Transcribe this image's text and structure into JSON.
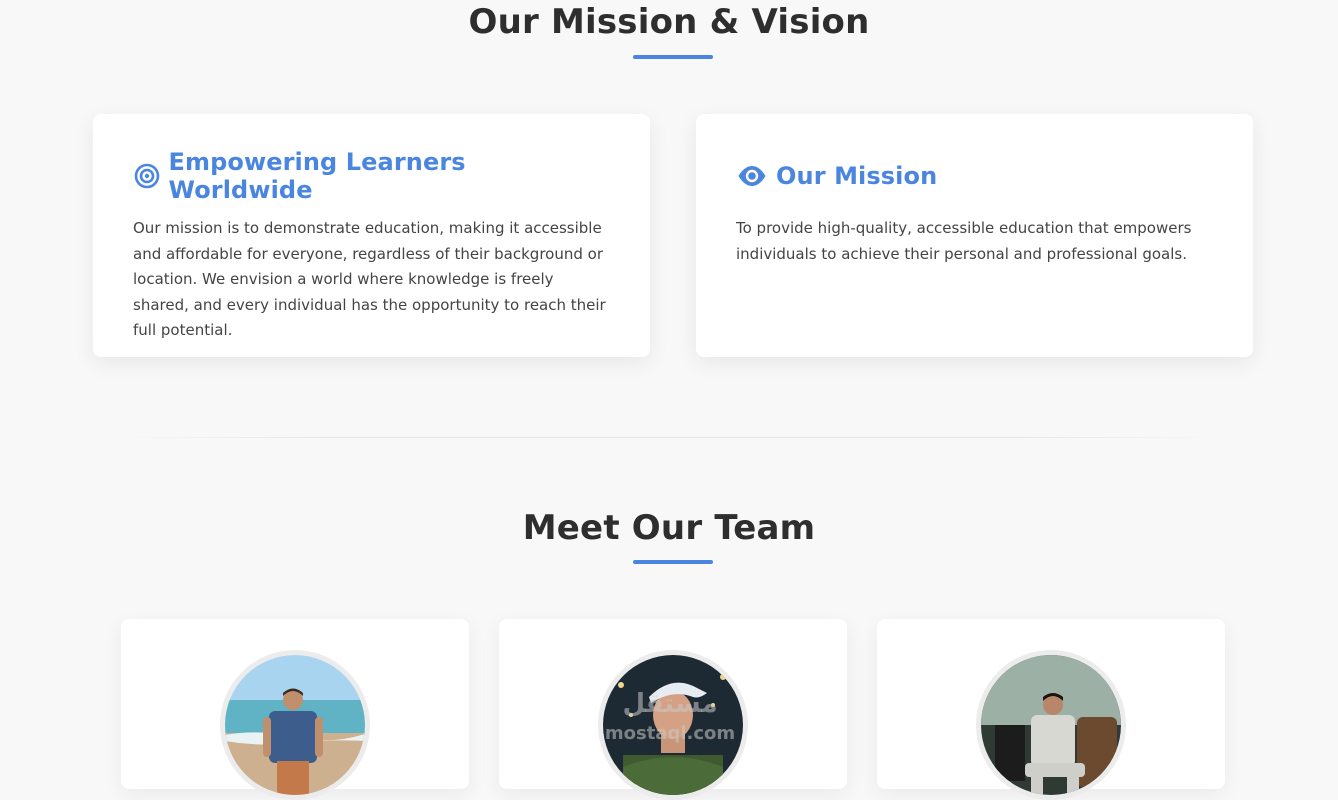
{
  "mission_section": {
    "title": "Our Mission & Vision",
    "cards": [
      {
        "icon": "target-icon",
        "heading": "Empowering Learners Worldwide",
        "text": "Our mission is to demonstrate education, making it accessible and affordable for everyone, regardless of their background or location. We envision a world where knowledge is freely shared, and every individual has the opportunity to reach their full potential."
      },
      {
        "icon": "eye-icon",
        "heading": "Our Mission",
        "text": "To provide high-quality, accessible education that empowers individuals to achieve their personal and professional goals."
      }
    ]
  },
  "team_section": {
    "title": "Meet Our Team",
    "members": [
      {
        "avatar": "team-member-photo-beach"
      },
      {
        "avatar": "team-member-photo-cap"
      },
      {
        "avatar": "team-member-photo-chair"
      }
    ]
  },
  "watermark": {
    "text": "مستقل",
    "sub": "mostaql.com"
  },
  "colors": {
    "accent": "#4a86e0",
    "background": "#f8f8f8",
    "card": "#ffffff",
    "heading": "#2e2e2e",
    "text": "#444444"
  }
}
